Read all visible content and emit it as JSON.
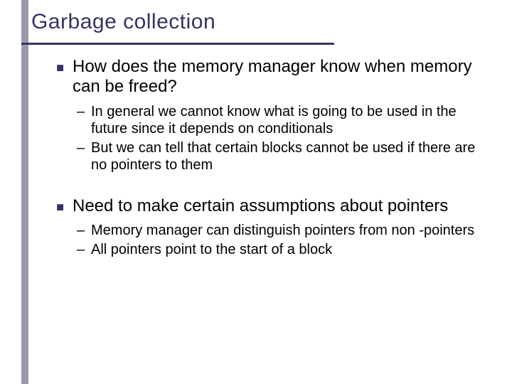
{
  "title": "Garbage collection",
  "bullets": [
    {
      "text": "How does the memory manager know when memory can be freed?",
      "subs": [
        "In general we cannot know what is going to be used in the future since it depends on conditionals",
        "But we can tell that certain blocks cannot be used if there are no pointers to them"
      ]
    },
    {
      "text": "Need to make certain assumptions about pointers",
      "subs": [
        "Memory manager can distinguish pointers from non -pointers",
        "All pointers point to the start of a block"
      ]
    }
  ]
}
